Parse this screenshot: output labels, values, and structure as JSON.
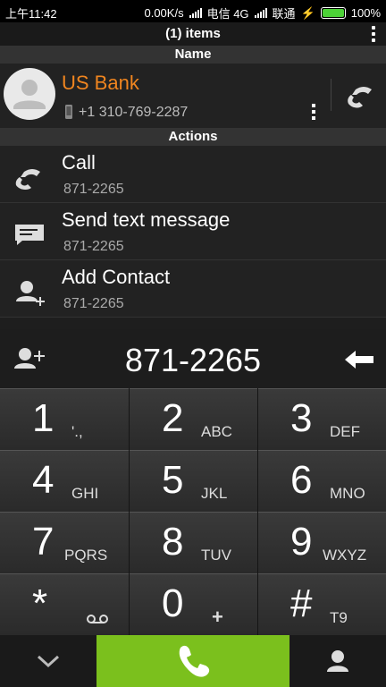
{
  "status_bar": {
    "time": "上午11:42",
    "speed": "0.00K/s",
    "carrier1": "电信 4G",
    "carrier2": "联通",
    "battery": "100%"
  },
  "header": {
    "title": "(1) items",
    "name_section": "Name",
    "actions_section": "Actions"
  },
  "contact": {
    "name": "US Bank",
    "number": "+1 310-769-2287"
  },
  "actions": [
    {
      "label": "Call",
      "number": "871-2265",
      "icon": "phone-icon"
    },
    {
      "label": "Send text message",
      "number": "871-2265",
      "icon": "message-icon"
    },
    {
      "label": "Add Contact",
      "number": "871-2265",
      "icon": "add-contact-icon"
    }
  ],
  "dial_entry": {
    "number": "871-2265"
  },
  "keypad": [
    {
      "digit": "1",
      "letters": "'.,"
    },
    {
      "digit": "2",
      "letters": "ABC"
    },
    {
      "digit": "3",
      "letters": "DEF"
    },
    {
      "digit": "4",
      "letters": "GHI"
    },
    {
      "digit": "5",
      "letters": "JKL"
    },
    {
      "digit": "6",
      "letters": "MNO"
    },
    {
      "digit": "7",
      "letters": "PQRS"
    },
    {
      "digit": "8",
      "letters": "TUV"
    },
    {
      "digit": "9",
      "letters": "WXYZ"
    },
    {
      "digit": "*",
      "letters": ""
    },
    {
      "digit": "0",
      "letters": "+"
    },
    {
      "digit": "#",
      "letters": "T9"
    }
  ],
  "colors": {
    "accent_orange": "#f0851f",
    "call_green": "#7bc01d"
  }
}
